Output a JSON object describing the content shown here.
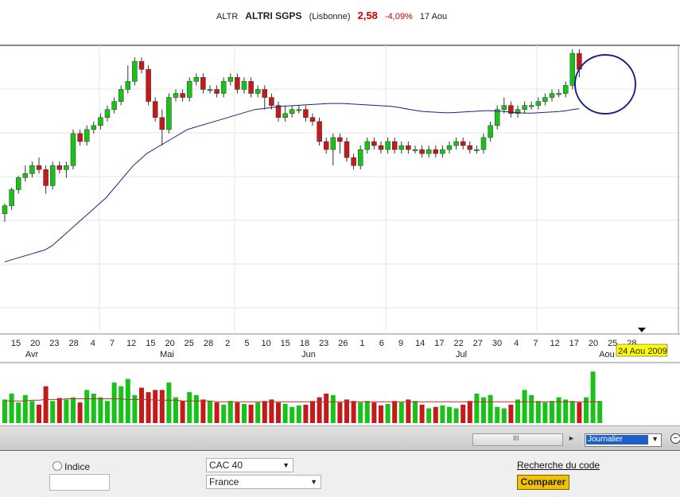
{
  "header": {
    "ticker": "ALTR",
    "name": "ALTRI SGPS",
    "market": "(Lisbonne)",
    "price": "2,58",
    "change": "-4,09%",
    "date": "17 Aou"
  },
  "colors": {
    "up": "#19c219",
    "down": "#c41a1a",
    "ma": "#1a237e",
    "volume_ma": "#b03030",
    "highlight": "#ffff00",
    "price": "#cc0000"
  },
  "chart_data": [
    {
      "type": "candlestick",
      "title": "",
      "x": [
        "15",
        "20",
        "23",
        "28",
        "4",
        "7",
        "12",
        "15",
        "20",
        "25",
        "28",
        "2",
        "5",
        "10",
        "15",
        "18",
        "23",
        "26",
        "1",
        "6",
        "9",
        "14",
        "17",
        "22",
        "27",
        "30",
        "4",
        "7",
        "12",
        "17",
        "20",
        "25",
        "28"
      ],
      "x_months": [
        "Avr",
        "Mai",
        "Jun",
        "Jul",
        "Aou"
      ],
      "grid": true,
      "annotation": "circle around last two sessions",
      "cursor_label": "24 Aou 2009",
      "candles": [
        {
          "o": 0.7,
          "c": 0.72,
          "h": 0.725,
          "l": 0.68
        },
        {
          "o": 0.72,
          "c": 0.76,
          "h": 0.765,
          "l": 0.71
        },
        {
          "o": 0.76,
          "c": 0.79,
          "h": 0.795,
          "l": 0.75
        },
        {
          "o": 0.79,
          "c": 0.8,
          "h": 0.82,
          "l": 0.78
        },
        {
          "o": 0.8,
          "c": 0.82,
          "h": 0.83,
          "l": 0.79
        },
        {
          "o": 0.82,
          "c": 0.81,
          "h": 0.84,
          "l": 0.8
        },
        {
          "o": 0.81,
          "c": 0.77,
          "h": 0.82,
          "l": 0.75
        },
        {
          "o": 0.77,
          "c": 0.82,
          "h": 0.83,
          "l": 0.76
        },
        {
          "o": 0.82,
          "c": 0.81,
          "h": 0.83,
          "l": 0.8
        },
        {
          "o": 0.81,
          "c": 0.82,
          "h": 0.83,
          "l": 0.79
        },
        {
          "o": 0.82,
          "c": 0.9,
          "h": 0.91,
          "l": 0.81
        },
        {
          "o": 0.9,
          "c": 0.88,
          "h": 0.91,
          "l": 0.87
        },
        {
          "o": 0.88,
          "c": 0.91,
          "h": 0.92,
          "l": 0.87
        },
        {
          "o": 0.91,
          "c": 0.92,
          "h": 0.93,
          "l": 0.9
        },
        {
          "o": 0.92,
          "c": 0.94,
          "h": 0.95,
          "l": 0.91
        },
        {
          "o": 0.94,
          "c": 0.96,
          "h": 0.97,
          "l": 0.93
        },
        {
          "o": 0.96,
          "c": 0.98,
          "h": 0.99,
          "l": 0.95
        },
        {
          "o": 0.98,
          "c": 1.01,
          "h": 1.02,
          "l": 0.97
        },
        {
          "o": 1.01,
          "c": 1.03,
          "h": 1.07,
          "l": 1.0
        },
        {
          "o": 1.03,
          "c": 1.08,
          "h": 1.09,
          "l": 1.02
        },
        {
          "o": 1.08,
          "c": 1.06,
          "h": 1.09,
          "l": 1.05
        },
        {
          "o": 1.06,
          "c": 0.98,
          "h": 1.07,
          "l": 0.97
        },
        {
          "o": 0.98,
          "c": 0.94,
          "h": 0.99,
          "l": 0.93
        },
        {
          "o": 0.94,
          "c": 0.91,
          "h": 0.96,
          "l": 0.87
        },
        {
          "o": 0.91,
          "c": 0.99,
          "h": 1.0,
          "l": 0.9
        },
        {
          "o": 0.99,
          "c": 1.0,
          "h": 1.01,
          "l": 0.98
        },
        {
          "o": 1.0,
          "c": 0.99,
          "h": 1.01,
          "l": 0.98
        },
        {
          "o": 0.99,
          "c": 1.03,
          "h": 1.04,
          "l": 0.98
        },
        {
          "o": 1.03,
          "c": 1.04,
          "h": 1.05,
          "l": 1.02
        },
        {
          "o": 1.04,
          "c": 1.01,
          "h": 1.05,
          "l": 1.0
        },
        {
          "o": 1.01,
          "c": 1.01,
          "h": 1.02,
          "l": 1.0
        },
        {
          "o": 1.01,
          "c": 1.0,
          "h": 1.02,
          "l": 0.99
        },
        {
          "o": 1.0,
          "c": 1.03,
          "h": 1.04,
          "l": 0.99
        },
        {
          "o": 1.03,
          "c": 1.04,
          "h": 1.05,
          "l": 1.02
        },
        {
          "o": 1.04,
          "c": 1.01,
          "h": 1.05,
          "l": 1.0
        },
        {
          "o": 1.01,
          "c": 1.03,
          "h": 1.04,
          "l": 1.0
        },
        {
          "o": 1.03,
          "c": 1.0,
          "h": 1.04,
          "l": 0.99
        },
        {
          "o": 1.0,
          "c": 1.01,
          "h": 1.02,
          "l": 0.99
        },
        {
          "o": 1.01,
          "c": 0.99,
          "h": 1.02,
          "l": 0.96
        },
        {
          "o": 0.99,
          "c": 0.97,
          "h": 1.0,
          "l": 0.96
        },
        {
          "o": 0.97,
          "c": 0.94,
          "h": 0.98,
          "l": 0.93
        },
        {
          "o": 0.94,
          "c": 0.95,
          "h": 0.97,
          "l": 0.93
        },
        {
          "o": 0.95,
          "c": 0.96,
          "h": 0.97,
          "l": 0.94
        },
        {
          "o": 0.96,
          "c": 0.96,
          "h": 0.97,
          "l": 0.95
        },
        {
          "o": 0.96,
          "c": 0.94,
          "h": 0.97,
          "l": 0.93
        },
        {
          "o": 0.94,
          "c": 0.93,
          "h": 0.95,
          "l": 0.92
        },
        {
          "o": 0.93,
          "c": 0.88,
          "h": 0.94,
          "l": 0.87
        },
        {
          "o": 0.88,
          "c": 0.86,
          "h": 0.89,
          "l": 0.85
        },
        {
          "o": 0.86,
          "c": 0.89,
          "h": 0.9,
          "l": 0.82
        },
        {
          "o": 0.89,
          "c": 0.88,
          "h": 0.9,
          "l": 0.85
        },
        {
          "o": 0.88,
          "c": 0.84,
          "h": 0.89,
          "l": 0.83
        },
        {
          "o": 0.84,
          "c": 0.82,
          "h": 0.85,
          "l": 0.81
        },
        {
          "o": 0.82,
          "c": 0.86,
          "h": 0.87,
          "l": 0.81
        },
        {
          "o": 0.86,
          "c": 0.88,
          "h": 0.89,
          "l": 0.85
        },
        {
          "o": 0.88,
          "c": 0.87,
          "h": 0.89,
          "l": 0.86
        },
        {
          "o": 0.87,
          "c": 0.86,
          "h": 0.88,
          "l": 0.85
        },
        {
          "o": 0.86,
          "c": 0.88,
          "h": 0.89,
          "l": 0.85
        },
        {
          "o": 0.88,
          "c": 0.86,
          "h": 0.89,
          "l": 0.85
        },
        {
          "o": 0.86,
          "c": 0.87,
          "h": 0.88,
          "l": 0.85
        },
        {
          "o": 0.87,
          "c": 0.86,
          "h": 0.88,
          "l": 0.85
        },
        {
          "o": 0.86,
          "c": 0.86,
          "h": 0.87,
          "l": 0.85
        },
        {
          "o": 0.86,
          "c": 0.85,
          "h": 0.87,
          "l": 0.84
        },
        {
          "o": 0.85,
          "c": 0.86,
          "h": 0.87,
          "l": 0.84
        },
        {
          "o": 0.86,
          "c": 0.85,
          "h": 0.87,
          "l": 0.84
        },
        {
          "o": 0.85,
          "c": 0.86,
          "h": 0.87,
          "l": 0.84
        },
        {
          "o": 0.86,
          "c": 0.87,
          "h": 0.88,
          "l": 0.85
        },
        {
          "o": 0.87,
          "c": 0.88,
          "h": 0.89,
          "l": 0.86
        },
        {
          "o": 0.88,
          "c": 0.87,
          "h": 0.89,
          "l": 0.86
        },
        {
          "o": 0.87,
          "c": 0.86,
          "h": 0.88,
          "l": 0.85
        },
        {
          "o": 0.86,
          "c": 0.86,
          "h": 0.87,
          "l": 0.85
        },
        {
          "o": 0.86,
          "c": 0.89,
          "h": 0.9,
          "l": 0.85
        },
        {
          "o": 0.89,
          "c": 0.92,
          "h": 0.93,
          "l": 0.88
        },
        {
          "o": 0.92,
          "c": 0.96,
          "h": 0.97,
          "l": 0.91
        },
        {
          "o": 0.96,
          "c": 0.97,
          "h": 0.99,
          "l": 0.95
        },
        {
          "o": 0.97,
          "c": 0.95,
          "h": 0.98,
          "l": 0.94
        },
        {
          "o": 0.95,
          "c": 0.96,
          "h": 0.97,
          "l": 0.94
        },
        {
          "o": 0.96,
          "c": 0.97,
          "h": 0.98,
          "l": 0.95
        },
        {
          "o": 0.97,
          "c": 0.97,
          "h": 0.98,
          "l": 0.96
        },
        {
          "o": 0.97,
          "c": 0.98,
          "h": 0.99,
          "l": 0.96
        },
        {
          "o": 0.98,
          "c": 0.99,
          "h": 1.0,
          "l": 0.97
        },
        {
          "o": 0.99,
          "c": 1.0,
          "h": 1.01,
          "l": 0.98
        },
        {
          "o": 1.0,
          "c": 1.0,
          "h": 1.01,
          "l": 0.99
        },
        {
          "o": 1.0,
          "c": 1.02,
          "h": 1.03,
          "l": 0.99
        },
        {
          "o": 1.02,
          "c": 1.1,
          "h": 1.11,
          "l": 1.01
        },
        {
          "o": 1.1,
          "c": 1.06,
          "h": 1.11,
          "l": 1.04
        }
      ],
      "moving_average": [
        0.58,
        0.585,
        0.59,
        0.595,
        0.6,
        0.605,
        0.61,
        0.62,
        0.635,
        0.65,
        0.665,
        0.68,
        0.695,
        0.71,
        0.725,
        0.74,
        0.76,
        0.78,
        0.8,
        0.82,
        0.835,
        0.85,
        0.86,
        0.87,
        0.88,
        0.89,
        0.9,
        0.91,
        0.915,
        0.92,
        0.925,
        0.93,
        0.935,
        0.94,
        0.945,
        0.95,
        0.955,
        0.96,
        0.962,
        0.964,
        0.966,
        0.968,
        0.969,
        0.97,
        0.971,
        0.972,
        0.973,
        0.974,
        0.975,
        0.975,
        0.975,
        0.974,
        0.973,
        0.972,
        0.971,
        0.97,
        0.969,
        0.968,
        0.966,
        0.963,
        0.96,
        0.957,
        0.955,
        0.954,
        0.953,
        0.952,
        0.952,
        0.953,
        0.954,
        0.955,
        0.956,
        0.957,
        0.957,
        0.956,
        0.955,
        0.953,
        0.952,
        0.951,
        0.951,
        0.952,
        0.953,
        0.954,
        0.955,
        0.957,
        0.96,
        0.962
      ],
      "ylim": [
        0.4,
        1.12
      ]
    },
    {
      "type": "bar",
      "title": "",
      "values": [
        32,
        40,
        28,
        38,
        30,
        25,
        50,
        30,
        34,
        32,
        35,
        28,
        45,
        40,
        35,
        30,
        55,
        50,
        60,
        38,
        48,
        42,
        45,
        45,
        55,
        35,
        30,
        42,
        38,
        32,
        30,
        28,
        25,
        30,
        28,
        26,
        25,
        28,
        30,
        32,
        28,
        26,
        22,
        24,
        25,
        30,
        35,
        40,
        38,
        28,
        32,
        30,
        28,
        30,
        28,
        24,
        26,
        30,
        28,
        32,
        30,
        25,
        20,
        22,
        24,
        22,
        20,
        25,
        30,
        40,
        35,
        38,
        22,
        20,
        25,
        32,
        45,
        38,
        30,
        28,
        30,
        35,
        32,
        30,
        28,
        35,
        70,
        30
      ],
      "moving_average": [
        30,
        30,
        30,
        30,
        31,
        31,
        32,
        32,
        32,
        33,
        33,
        33,
        33,
        33,
        33,
        33,
        33,
        33,
        32,
        32,
        32,
        32,
        31,
        31,
        31,
        31,
        30,
        30,
        30,
        30,
        30,
        29,
        29,
        29,
        29,
        29,
        29,
        29,
        29,
        29,
        29,
        29,
        29,
        29,
        29,
        29,
        29,
        29,
        29,
        29,
        29,
        29,
        29,
        29,
        29,
        29,
        29,
        29,
        29,
        29,
        29,
        29,
        29,
        29,
        29,
        29,
        29,
        29,
        29,
        29,
        29,
        29,
        29,
        29,
        29,
        29,
        29,
        29,
        29,
        29,
        29,
        29,
        29,
        29,
        29,
        29,
        29,
        29
      ],
      "ylim": [
        0,
        80
      ]
    }
  ],
  "scrollbar": {
    "grip": "III",
    "arrow": "►"
  },
  "period": {
    "value": "Journalier"
  },
  "controls": {
    "indice_label": "Indice",
    "indice_value": "",
    "index_select": "CAC 40",
    "country_select": "France",
    "search_link": "Recherche du code",
    "compare_button": "Comparer"
  }
}
